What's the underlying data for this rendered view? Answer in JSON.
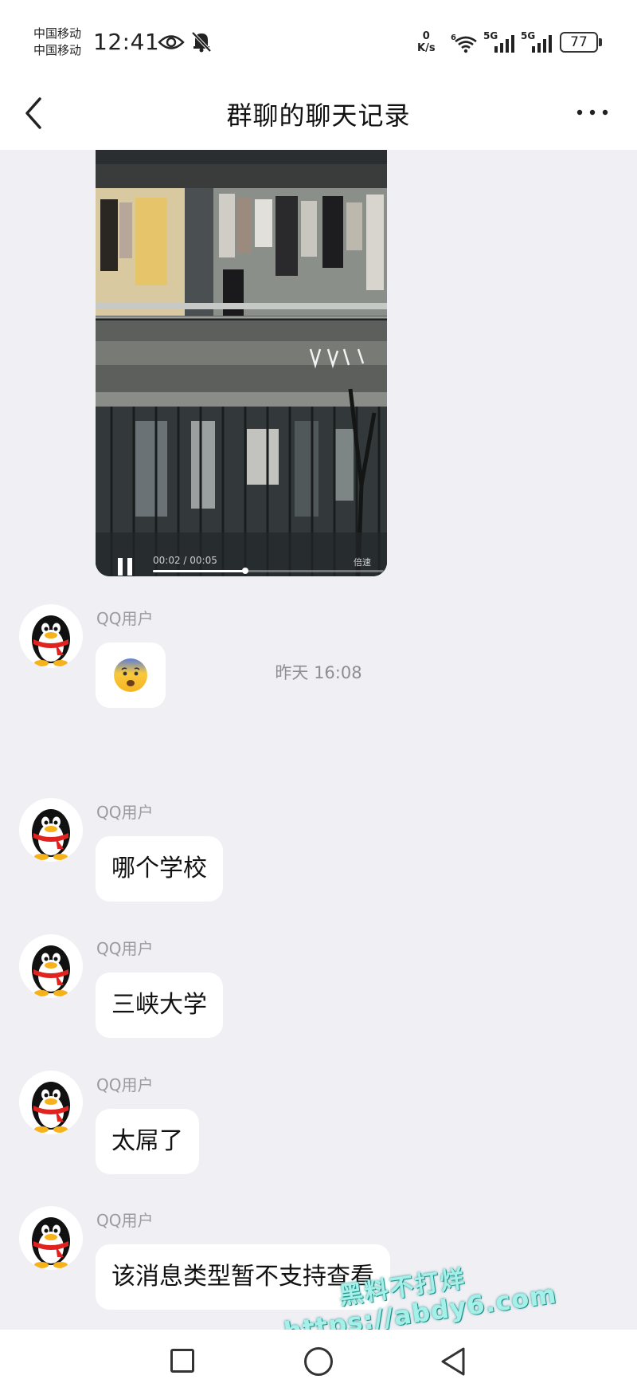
{
  "status_bar": {
    "carrier_1": "中国移动",
    "carrier_2": "中国移动",
    "time": "12:41",
    "net_speed_value": "0",
    "net_speed_unit": "K/s",
    "wifi_label": "6",
    "signal_1_label": "5G",
    "signal_2_label": "5G",
    "battery": "77"
  },
  "header": {
    "title": "群聊的聊天记录"
  },
  "video": {
    "time": "00:02 / 00:05",
    "speed_label": "倍速",
    "progress": 0.4
  },
  "messages": [
    {
      "sender": "QQ用户",
      "type": "emoji",
      "content": "😨"
    },
    {
      "type": "timestamp",
      "content": "昨天 16:08"
    },
    {
      "sender": "QQ用户",
      "type": "text",
      "content": "哪个学校"
    },
    {
      "sender": "QQ用户",
      "type": "text",
      "content": "三峡大学"
    },
    {
      "sender": "QQ用户",
      "type": "text",
      "content": "太屌了"
    },
    {
      "sender": "QQ用户",
      "type": "text",
      "content": "该消息类型暂不支持查看"
    }
  ],
  "watermark": {
    "line1": "黑料不打烊",
    "line2": "https://abdy6.com"
  },
  "colors": {
    "background": "#efeff4",
    "bubble": "#ffffff",
    "sender_name": "#9a9a9f",
    "watermark": "#a6f0ea"
  }
}
